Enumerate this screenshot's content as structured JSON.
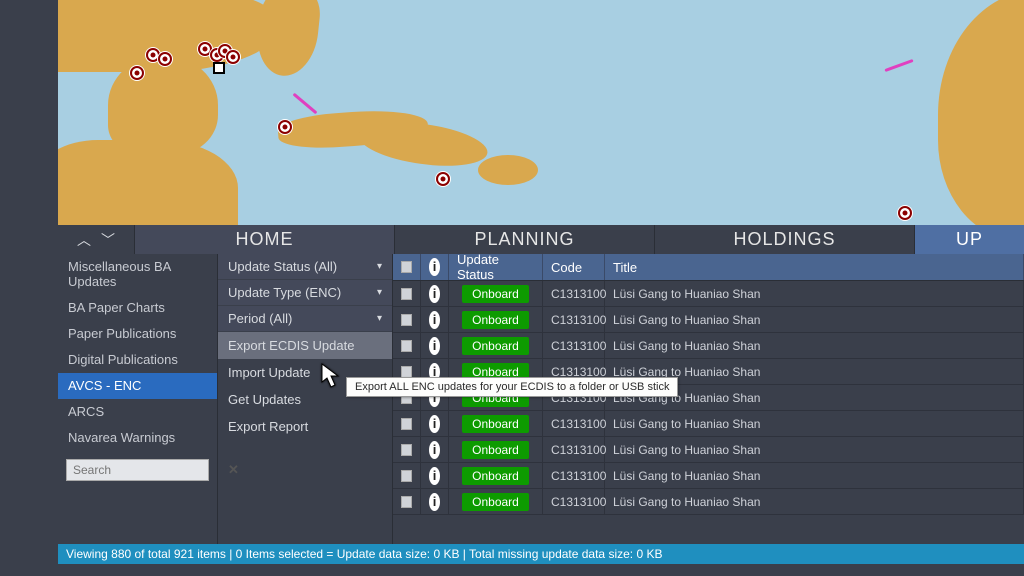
{
  "tabs": {
    "home": "HOME",
    "planning": "PLANNING",
    "holdings": "HOLDINGS",
    "up": "UP"
  },
  "sidebar": {
    "items": [
      "Miscellaneous BA Updates",
      "BA Paper Charts",
      "Paper Publications",
      "Digital Publications",
      "AVCS - ENC",
      "ARCS",
      "Navarea Warnings"
    ],
    "active_index": 4,
    "search_placeholder": "Search"
  },
  "filters": {
    "update_status": "Update Status (All)",
    "update_type": "Update Type (ENC)",
    "period": "Period (All)"
  },
  "actions": {
    "export_ecdis": "Export ECDIS Update",
    "import_update": "Import Update",
    "get_updates": "Get Updates",
    "export_report": "Export Report"
  },
  "tooltip": "Export ALL ENC updates for your ECDIS to a folder or USB stick",
  "table": {
    "headers": {
      "update_status": "Update Status",
      "code": "Code",
      "title": "Title"
    },
    "status_label": "Onboard",
    "rows": [
      {
        "code": "C1313100",
        "title": "Lüsi Gang to Huaniao Shan"
      },
      {
        "code": "C1313100",
        "title": "Lüsi Gang to Huaniao Shan"
      },
      {
        "code": "C1313100",
        "title": "Lüsi Gang to Huaniao Shan"
      },
      {
        "code": "C1313100",
        "title": "Lüsi Gang to Huaniao Shan"
      },
      {
        "code": "C1313100",
        "title": "Lüsi Gang to Huaniao Shan"
      },
      {
        "code": "C1313100",
        "title": "Lüsi Gang to Huaniao Shan"
      },
      {
        "code": "C1313100",
        "title": "Lüsi Gang to Huaniao Shan"
      },
      {
        "code": "C1313100",
        "title": "Lüsi Gang to Huaniao Shan"
      },
      {
        "code": "C1313100",
        "title": "Lüsi Gang to Huaniao Shan"
      }
    ]
  },
  "statusbar": "Viewing 880 of total 921 items | 0 Items selected = Update data size: 0 KB | Total missing update data size: 0 KB",
  "icons": {
    "info": "i",
    "close": "✕",
    "chev_down": "▾",
    "up": "︿",
    "down": "﹀"
  }
}
